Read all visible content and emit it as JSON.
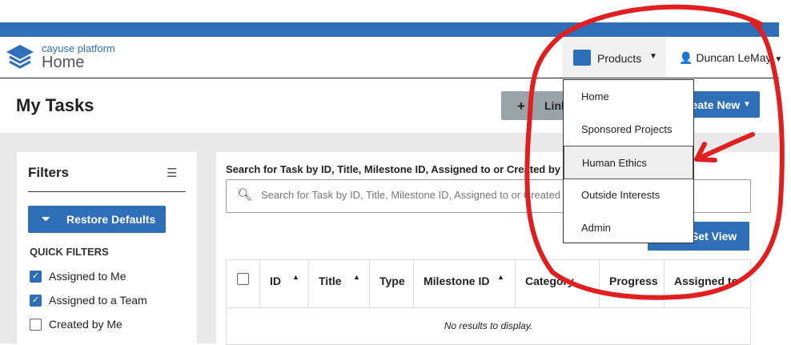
{
  "brand": {
    "name": "cayuse platform",
    "section": "Home"
  },
  "nav": {
    "products_label": "Products",
    "user_name": "Duncan LeMay"
  },
  "page": {
    "title": "My Tasks",
    "link_button": "Link",
    "new_button": "Create New"
  },
  "products_menu": {
    "items": [
      "Home",
      "Sponsored Projects",
      "Human Ethics",
      "Outside Interests",
      "Admin"
    ],
    "selected": "Human Ethics"
  },
  "filters": {
    "title": "Filters",
    "restore_label": "Restore Defaults",
    "quick_filters_heading": "QUICK FILTERS",
    "items": [
      {
        "label": "Assigned to Me",
        "checked": true
      },
      {
        "label": "Assigned to a Team",
        "checked": true
      },
      {
        "label": "Created by Me",
        "checked": false
      }
    ]
  },
  "search": {
    "label": "Search for Task by ID, Title, Milestone ID, Assigned to or Created by",
    "placeholder": "Search for Task by ID, Title, Milestone ID, Assigned to or Created by"
  },
  "table": {
    "set_view_label": "Set View",
    "columns": [
      "ID",
      "Title",
      "Type",
      "Milestone ID",
      "Category",
      "Progress",
      "Assigned to"
    ],
    "empty_message": "No results to display."
  },
  "colors": {
    "primary": "#2f6fb8",
    "annotation": "#e02020"
  },
  "icons": {
    "logo": "cayuse-layers-logo",
    "products": "products-app-icon",
    "user": "user-icon",
    "filters": "sliders-icon",
    "restore": "filter-reset-icon",
    "search": "search-icon",
    "sort": "sort-up-icon"
  }
}
